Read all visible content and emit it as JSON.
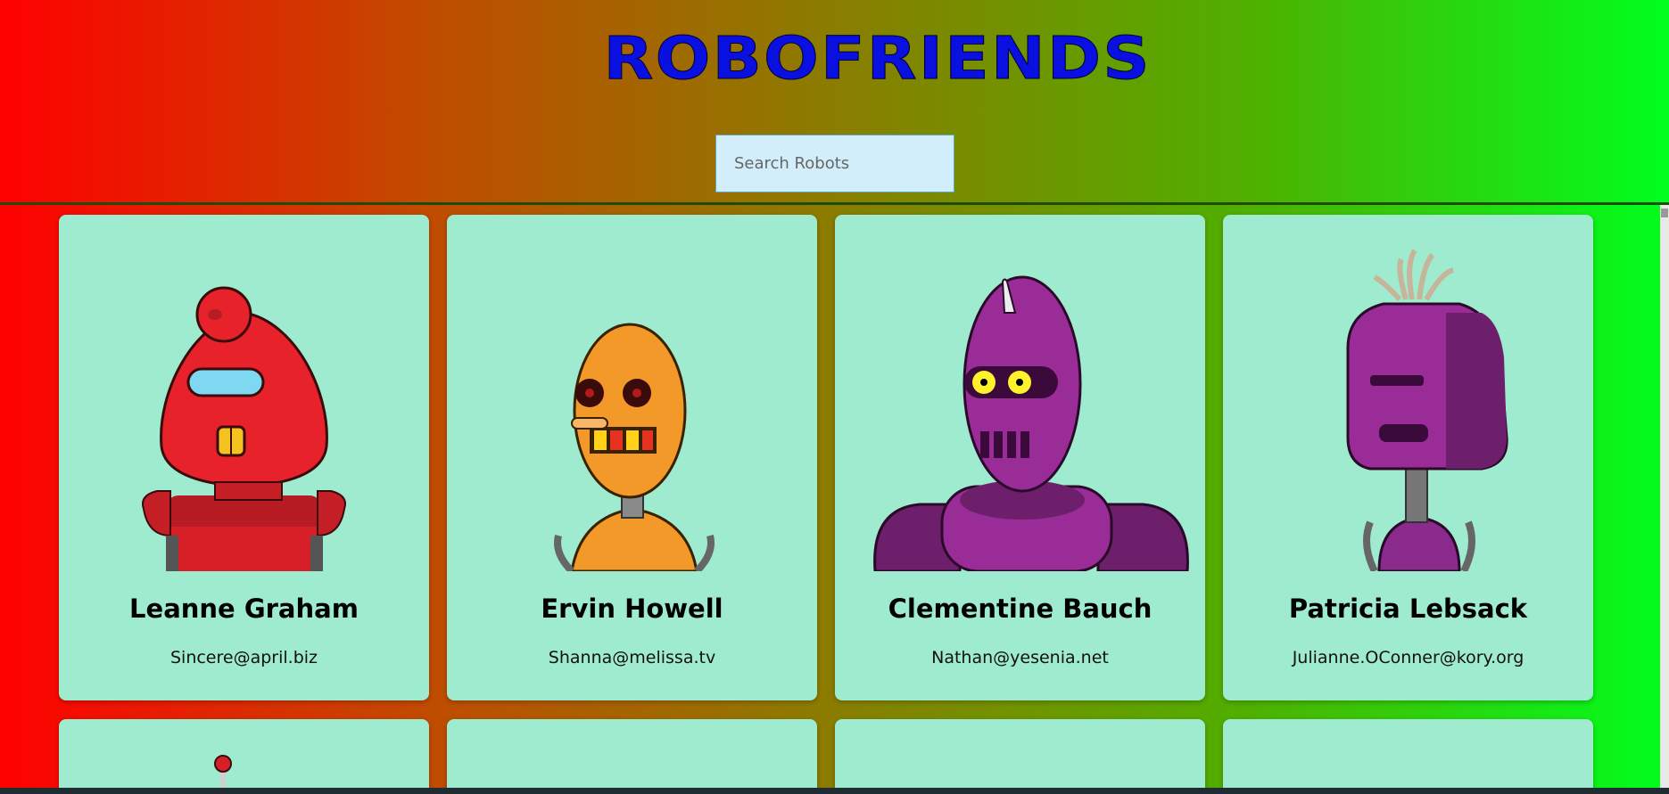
{
  "app": {
    "title": "ROBOFRIENDS"
  },
  "search": {
    "placeholder": "Search Robots",
    "value": ""
  },
  "robots": [
    {
      "name": "Leanne Graham",
      "email": "Sincere@april.biz",
      "color": "#e8222a"
    },
    {
      "name": "Ervin Howell",
      "email": "Shanna@melissa.tv",
      "color": "#f2992a"
    },
    {
      "name": "Clementine Bauch",
      "email": "Nathan@yesenia.net",
      "color": "#9a2c97"
    },
    {
      "name": "Patricia Lebsack",
      "email": "Julianne.OConner@kory.org",
      "color": "#8a2a8c"
    }
  ],
  "colors": {
    "card_bg": "#9eebcf",
    "gradient_start": "#ff0000",
    "gradient_end": "#00ff1e",
    "title": "#0a10e0",
    "search_bg": "#d3eefb"
  }
}
